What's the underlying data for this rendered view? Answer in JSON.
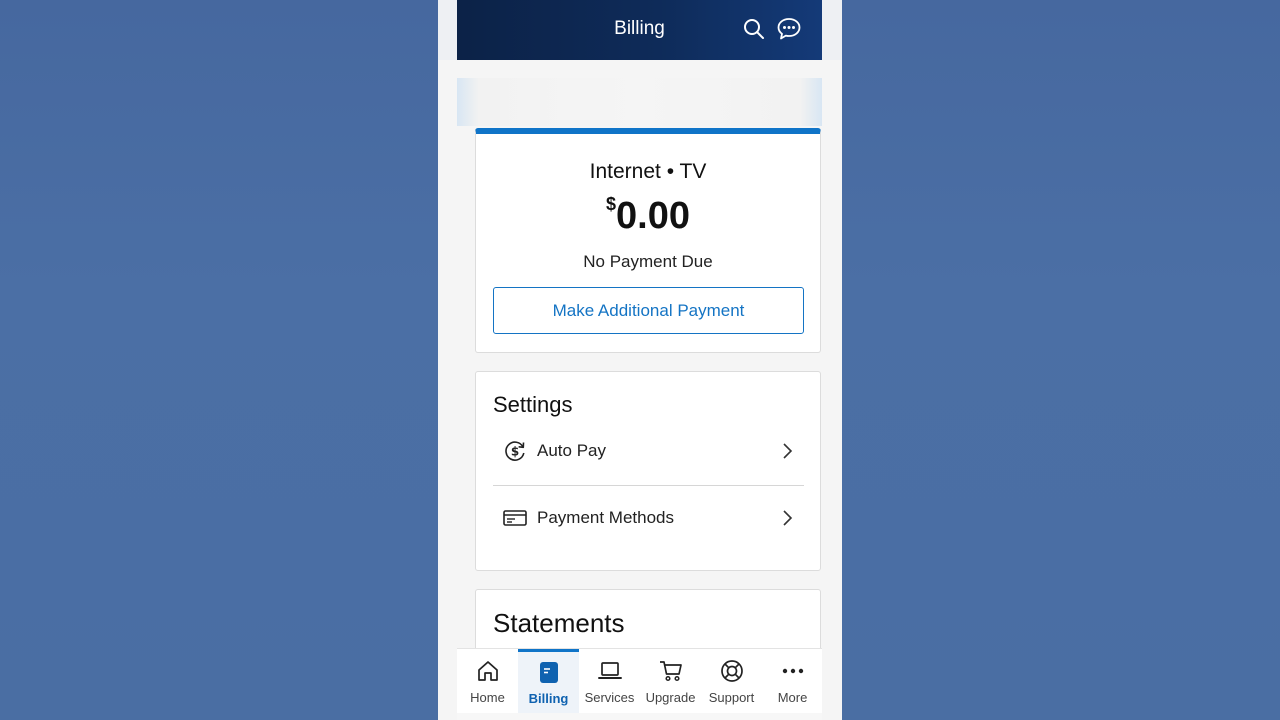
{
  "header": {
    "title": "Billing",
    "background": "#0e2b59"
  },
  "balance_card": {
    "services": "Internet • TV",
    "currency_symbol": "$",
    "amount": "0.00",
    "status": "No Payment Due",
    "button_label": "Make Additional Payment",
    "accent": "#0f74c8"
  },
  "settings": {
    "title": "Settings",
    "items": [
      {
        "label": "Auto Pay",
        "icon": "autopay-icon"
      },
      {
        "label": "Payment Methods",
        "icon": "credit-card-icon"
      }
    ]
  },
  "statements": {
    "title": "Statements"
  },
  "tabbar": {
    "active": "Billing",
    "tabs": [
      {
        "label": "Home",
        "icon": "home-icon"
      },
      {
        "label": "Billing",
        "icon": "billing-icon"
      },
      {
        "label": "Services",
        "icon": "laptop-icon"
      },
      {
        "label": "Upgrade",
        "icon": "cart-icon"
      },
      {
        "label": "Support",
        "icon": "lifebuoy-icon"
      },
      {
        "label": "More",
        "icon": "more-icon"
      }
    ]
  }
}
